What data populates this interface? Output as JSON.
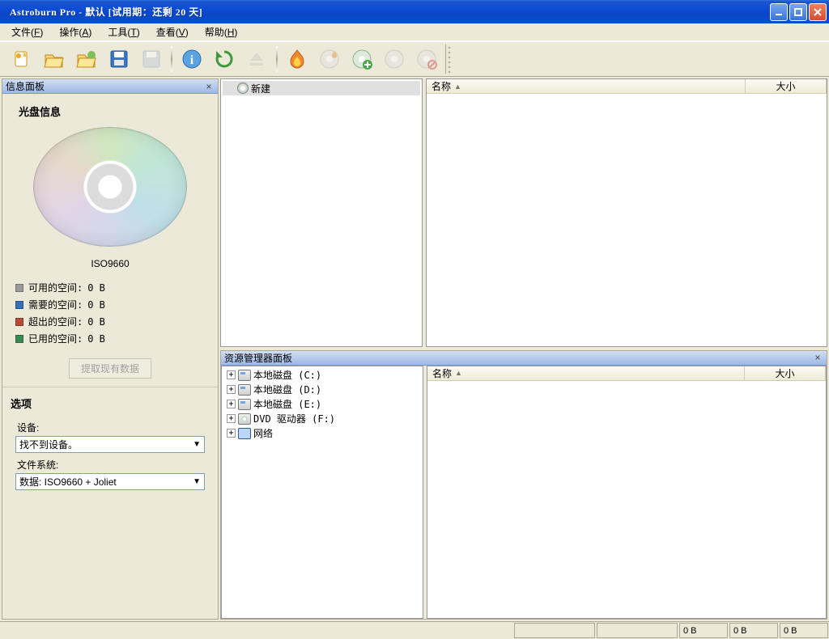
{
  "title": "Astroburn Pro - 默认  [试用期：还剩 20 天]",
  "menu": {
    "file": {
      "label": "文件(",
      "accel": "F",
      "tail": ")"
    },
    "ops": {
      "label": "操作(",
      "accel": "A",
      "tail": ")"
    },
    "tools": {
      "label": "工具(",
      "accel": "T",
      "tail": ")"
    },
    "view": {
      "label": "查看(",
      "accel": "V",
      "tail": ")"
    },
    "help": {
      "label": "帮助(",
      "accel": "H",
      "tail": ")"
    }
  },
  "toolbar": {
    "icons": [
      "new-project-icon",
      "open-icon",
      "open-recent-icon",
      "save-icon",
      "save-as-icon",
      "info-icon",
      "refresh-icon",
      "eject-icon",
      "burn-icon",
      "burn-image-icon",
      "add-to-disc-icon",
      "disc-options-icon",
      "disc-cancel-icon"
    ]
  },
  "left": {
    "pane_title": "信息面板",
    "disc_section_title": "光盘信息",
    "iso_label": "ISO9660",
    "legend": [
      {
        "name": "可用的空间:",
        "val": "0 B",
        "color": "#9a9a9a"
      },
      {
        "name": "需要的空间:",
        "val": "0 B",
        "color": "#3b6fb5"
      },
      {
        "name": "超出的空间:",
        "val": "0 B",
        "color": "#b84a3a"
      },
      {
        "name": "已用的空间:",
        "val": "0 B",
        "color": "#3c8a55"
      }
    ],
    "extract_btn": "提取现有数据",
    "options_title": "选项",
    "device_label": "设备:",
    "device_value": "找不到设备。",
    "fs_label": "文件系统:",
    "fs_value": "数据: ISO9660 + Joliet"
  },
  "right": {
    "top_pane_title": "资源管理器面板",
    "compile_tree_root": "新建",
    "list_cols": {
      "name": "名称",
      "size": "大小"
    },
    "explorer_tree": [
      {
        "icon": "drv",
        "label": "本地磁盘 (C:)"
      },
      {
        "icon": "drv",
        "label": "本地磁盘 (D:)"
      },
      {
        "icon": "drv",
        "label": "本地磁盘 (E:)"
      },
      {
        "icon": "dvd",
        "label": "DVD 驱动器 (F:)"
      },
      {
        "icon": "net",
        "label": "网络"
      }
    ]
  },
  "status": {
    "b1": "",
    "b2": "",
    "b3": "0 B",
    "b4": "0 B",
    "b5": "0 B"
  }
}
